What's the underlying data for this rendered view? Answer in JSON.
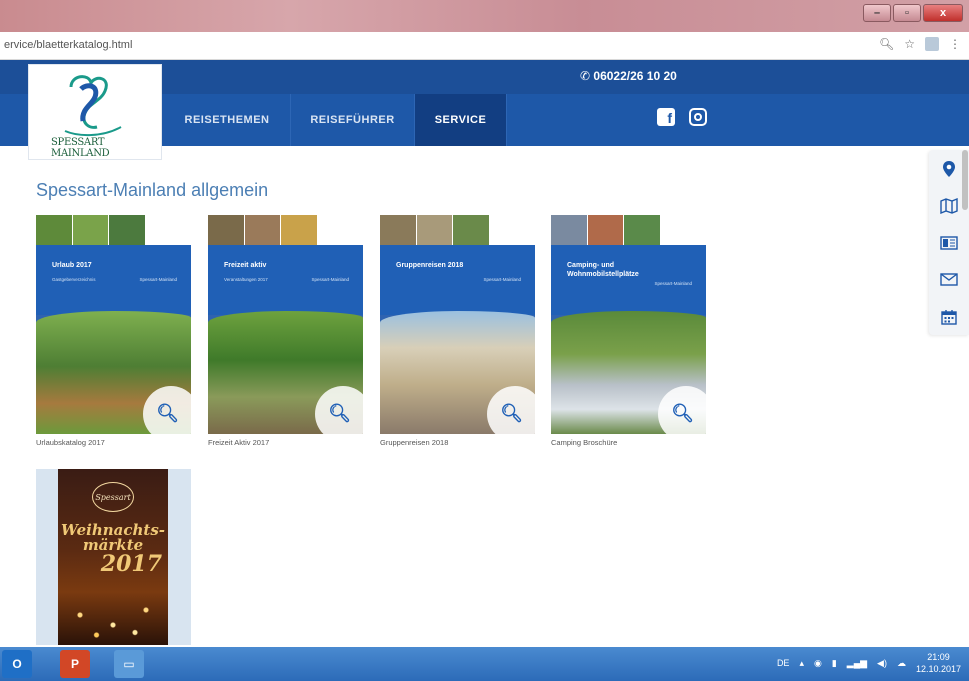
{
  "browser": {
    "url": "ervice/blaetterkatalog.html",
    "window_buttons": {
      "minimize": "–",
      "maximize": "▫",
      "close": "x"
    }
  },
  "site": {
    "phone": "06022/26 10 20",
    "logo_text": "SPESSART MAINLAND",
    "nav": [
      "REISETHEMEN",
      "REISEFÜHRER",
      "SERVICE"
    ],
    "active_nav": "SERVICE",
    "accent": "#1e58a8"
  },
  "main": {
    "heading": "Spessart-Mainland allgemein",
    "catalogs": [
      {
        "cover_title": "Urlaub 2017",
        "cover_sub_left": "Gastgeberverzeichnis",
        "cover_sub_right": "Spessart-Mainland",
        "caption": "Urlaubskatalog 2017"
      },
      {
        "cover_title": "Freizeit aktiv",
        "cover_sub_left": "Veranstaltungen 2017",
        "cover_sub_right": "Spessart-Mainland",
        "caption": "Freizeit Aktiv 2017"
      },
      {
        "cover_title": "Gruppenreisen 2018",
        "cover_sub_left": "",
        "cover_sub_right": "Spessart-Mainland",
        "caption": "Gruppenreisen 2018"
      },
      {
        "cover_title": "Camping- und Wohnmobilstellplätze",
        "cover_sub_left": "",
        "cover_sub_right": "Spessart-Mainland",
        "caption": "Camping Broschüre"
      }
    ],
    "xmas": {
      "badge": "Spessart",
      "title": "Weihnachts-märkte",
      "year": "2017"
    }
  },
  "side_tools": [
    "map-pin-icon",
    "map-icon",
    "brochure-icon",
    "mail-icon",
    "calendar-icon"
  ],
  "taskbar": {
    "language": "DE",
    "time": "21:09",
    "date": "12.10.2017"
  }
}
